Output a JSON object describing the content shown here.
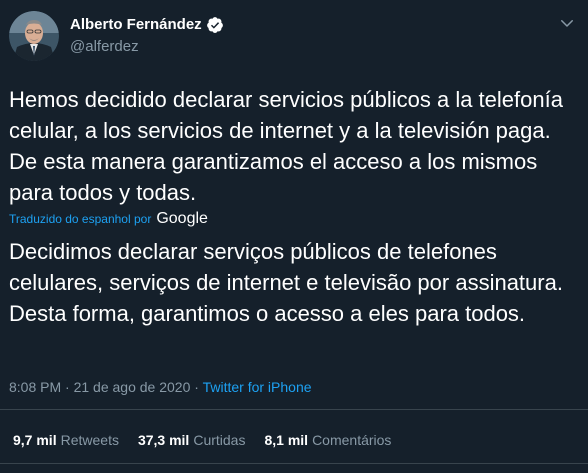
{
  "author": {
    "display_name": "Alberto Fernández",
    "handle": "@alferdez",
    "verified": true
  },
  "tweet": {
    "text_original": "Hemos decidido declarar servicios públicos a la telefonía celular, a los servicios de internet y a la televisión paga. De esta manera garantizamos el acceso a los mismos para todos y todas.",
    "translated_by_label": "Traduzido do espanhol por",
    "translation_provider": "Google",
    "text_translated": "Decidimos declarar serviços públicos de telefones celulares, serviços de internet e televisão por assinatura. Desta forma, garantimos o acesso a eles para todos.",
    "time": "8:08 PM",
    "separator": " · ",
    "date": "21 de ago de 2020",
    "source": "Twitter for iPhone"
  },
  "stats": {
    "retweets_count": "9,7 mil",
    "retweets_label": "Retweets",
    "likes_count": "37,3 mil",
    "likes_label": "Curtidas",
    "comments_count": "8,1 mil",
    "comments_label": "Comentários"
  },
  "icons": {
    "verified": "verified-badge-icon",
    "more": "chevron-down-icon"
  },
  "colors": {
    "background": "#15202b",
    "text": "#ffffff",
    "secondary": "#8899a6",
    "accent": "#1da1f2",
    "divider": "#38444d"
  }
}
